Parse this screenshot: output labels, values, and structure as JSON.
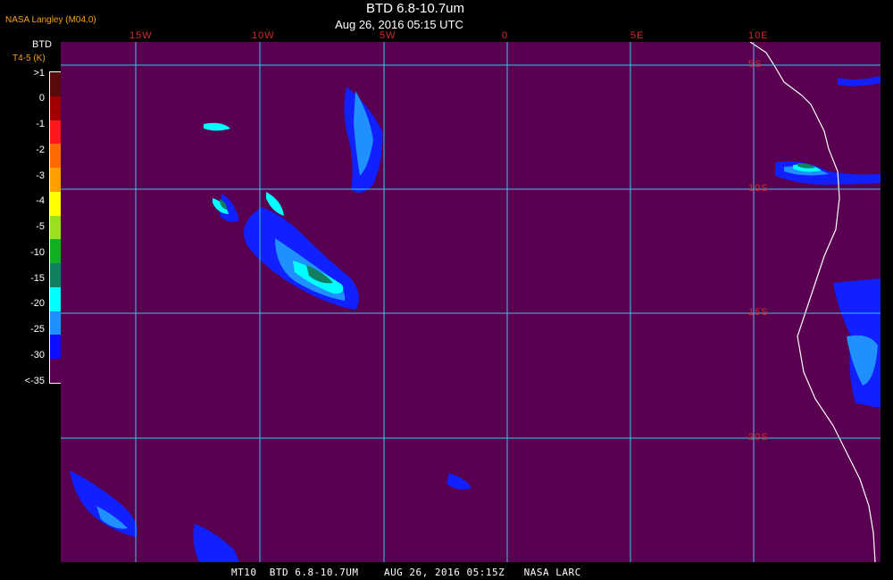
{
  "header": {
    "org_label": "NASA Langley (M04.0)",
    "title": "BTD 6.8-10.7um",
    "subtitle": "Aug 26, 2016 05:15 UTC"
  },
  "legend": {
    "title": "BTD",
    "units": "T4-5 (K)",
    "ticks": [
      ">1",
      "0",
      "-1",
      "-2",
      "-3",
      "-4",
      "-5",
      "-10",
      "-15",
      "-20",
      "-25",
      "-30",
      "<-35"
    ],
    "colors": [
      "#5a0a0a",
      "#a00000",
      "#ff1818",
      "#ff6a00",
      "#ffa000",
      "#ffff00",
      "#98e020",
      "#10b020",
      "#108060",
      "#00ffff",
      "#2090ff",
      "#0a10ff",
      "#5a0050"
    ]
  },
  "map": {
    "background": "#5a0050",
    "grid_color": "#36c8e8",
    "label_color": "#d42a2a",
    "lon_labels": [
      "15W",
      "10W",
      "5W",
      "0",
      "5E",
      "10E"
    ],
    "lat_labels": [
      "5S",
      "10S",
      "15S",
      "20S"
    ]
  },
  "footer": {
    "text": "MT10  BTD 6.8-10.7UM    AUG 26, 2016 05:15Z   NASA LARC"
  }
}
